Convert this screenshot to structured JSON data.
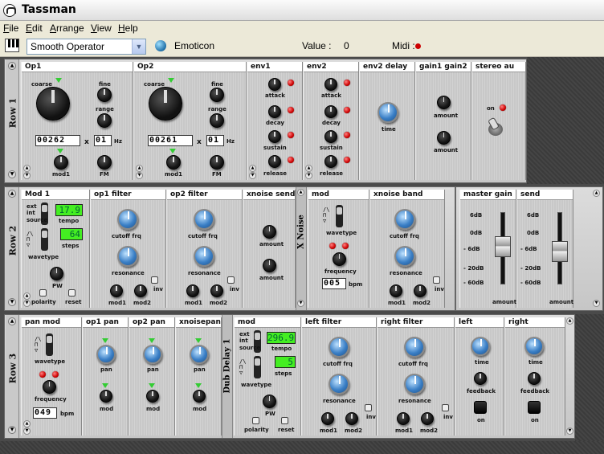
{
  "window": {
    "title": "Tassman"
  },
  "menu": [
    "File",
    "Edit",
    "Arrange",
    "View",
    "Help"
  ],
  "toolbar": {
    "preset": "Smooth Operator",
    "preset_name": "Emoticon",
    "value_label": "Value :",
    "value": "0",
    "midi_label": "Midi :"
  },
  "rows": {
    "row1": "Row 1",
    "row2": "Row 2",
    "row3": "Row 3"
  },
  "r1": {
    "op1": {
      "title": "Op1",
      "coarse": "coarse",
      "fine": "fine",
      "range": "range",
      "x": "x",
      "hz": "Hz",
      "digits": "00262",
      "ratio": "01",
      "mod1": "mod1",
      "fm": "FM"
    },
    "op2": {
      "title": "Op2",
      "coarse": "coarse",
      "fine": "fine",
      "range": "range",
      "x": "x",
      "hz": "Hz",
      "digits": "00261",
      "ratio": "01",
      "mod1": "mod1",
      "fm": "FM"
    },
    "env1": {
      "title": "env1",
      "attack": "attack",
      "decay": "decay",
      "sustain": "sustain",
      "release": "release"
    },
    "env2": {
      "title": "env2",
      "attack": "attack",
      "decay": "decay",
      "sustain": "sustain",
      "release": "release"
    },
    "env2delay": {
      "title": "env2 delay",
      "time": "time"
    },
    "gain": {
      "title": "gain1 gain2",
      "amount1": "amount",
      "amount2": "amount"
    },
    "stereo": {
      "title": "stereo au",
      "on": "on"
    }
  },
  "r2": {
    "mod1": {
      "title": "Mod 1",
      "ext": "ext",
      "int": "int",
      "source": "source",
      "tempo_val": "17.9",
      "tempo": "tempo",
      "steps_val": "64",
      "steps": "steps",
      "wavetype": "wavetype",
      "pw": "PW",
      "polarity": "polarity",
      "reset": "reset"
    },
    "op1f": {
      "title": "op1 filter",
      "cutoff": "cutoff frq",
      "res": "resonance",
      "inv": "inv",
      "mod1": "mod1",
      "mod2": "mod2"
    },
    "op2f": {
      "title": "op2 filter",
      "cutoff": "cutoff frq",
      "res": "resonance",
      "inv": "inv",
      "mod1": "mod1",
      "mod2": "mod2"
    },
    "xns": {
      "title": "xnoise send",
      "a1": "amount",
      "a2": "amount"
    },
    "xnoise_label": "X Noise",
    "xmod": {
      "title": "mod",
      "wavetype": "wavetype",
      "frequency": "frequency",
      "bpm": "bpm",
      "digits": "005"
    },
    "xband": {
      "title": "xnoise band",
      "cutoff": "cutoff frq",
      "res": "resonance",
      "inv": "inv",
      "mod1": "mod1",
      "mod2": "mod2"
    },
    "master": {
      "title": "master gain",
      "amount": "amount",
      "scale": [
        "6dB",
        "0dB",
        "- 6dB",
        "- 20dB",
        "- 60dB"
      ]
    },
    "send": {
      "title": "send",
      "amount": "amount",
      "scale": [
        "6dB",
        "0dB",
        "- 6dB",
        "- 20dB",
        "- 60dB"
      ]
    }
  },
  "r3": {
    "panmod": {
      "title": "pan mod",
      "wavetype": "wavetype",
      "frequency": "frequency",
      "bpm": "bpm",
      "digits": "049"
    },
    "op1pan": {
      "title": "op1 pan",
      "pan": "pan",
      "mod": "mod"
    },
    "op2pan": {
      "title": "op2 pan",
      "pan": "pan",
      "mod": "mod"
    },
    "xpan": {
      "title": "xnoisepan",
      "pan": "pan",
      "mod": "mod"
    },
    "dub_label": "Dub Delay 1",
    "dmod": {
      "title": "mod",
      "ext": "ext",
      "int": "int",
      "source": "source",
      "tempo_val": "296.9",
      "tempo": "tempo",
      "steps_val": "5",
      "steps": "steps",
      "wavetype": "wavetype",
      "pw": "PW",
      "polarity": "polarity",
      "reset": "reset"
    },
    "lf": {
      "title": "left filter",
      "cutoff": "cutoff frq",
      "res": "resonance",
      "inv": "inv",
      "mod1": "mod1",
      "mod2": "mod2"
    },
    "rf": {
      "title": "right filter",
      "cutoff": "cutoff frq",
      "res": "resonance",
      "inv": "inv",
      "mod1": "mod1",
      "mod2": "mod2"
    },
    "left": {
      "title": "left",
      "time": "time",
      "feedback": "feedback",
      "on": "on"
    },
    "right": {
      "title": "right",
      "time": "time",
      "feedback": "feedback",
      "on": "on"
    }
  }
}
